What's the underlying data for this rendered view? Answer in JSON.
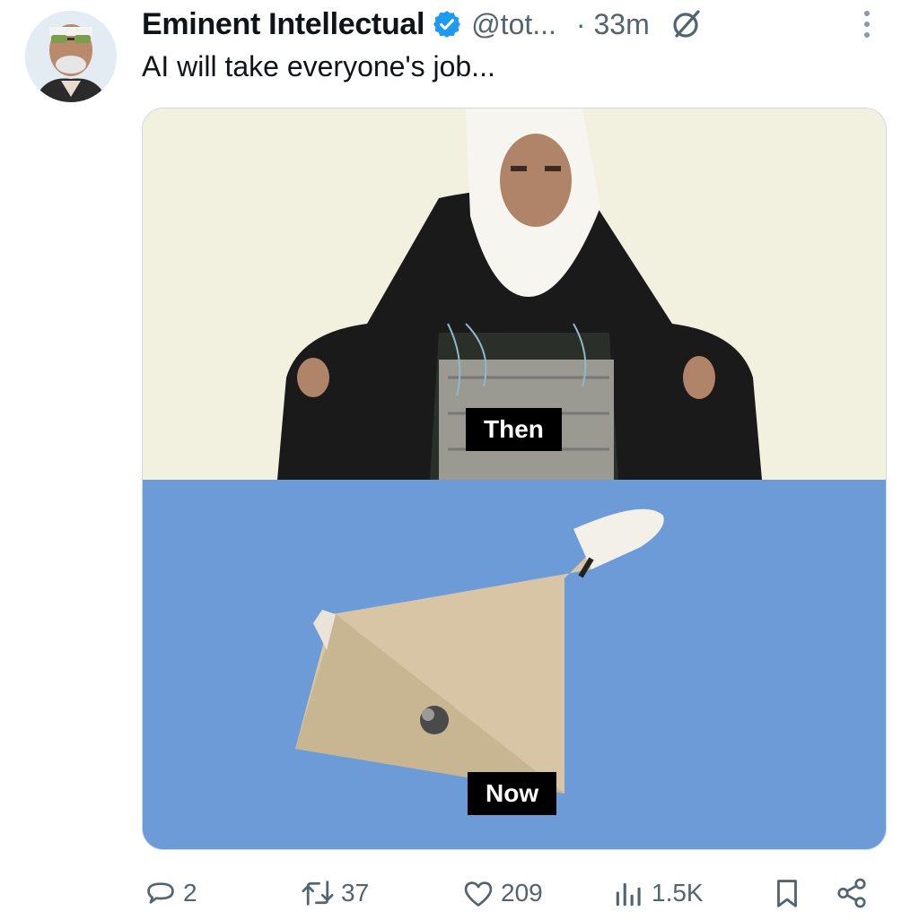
{
  "tweet": {
    "display_name": "Eminent Intellectual",
    "handle": "@tot...",
    "time": "· 33m",
    "text": "AI will take everyone's job...",
    "verified": true
  },
  "media": {
    "top_caption": "Then",
    "bottom_caption": "Now"
  },
  "actions": {
    "replies": "2",
    "reposts": "37",
    "likes": "209",
    "views": "1.5K"
  },
  "colors": {
    "verified": "#1d9bf0",
    "secondary_text": "#536471",
    "sky": "#6d9bd8",
    "wall": "#f2f0df"
  },
  "icons": [
    "verified-badge-icon",
    "grok-icon",
    "more-icon",
    "reply-icon",
    "repost-icon",
    "like-icon",
    "views-icon",
    "bookmark-icon",
    "share-icon"
  ]
}
